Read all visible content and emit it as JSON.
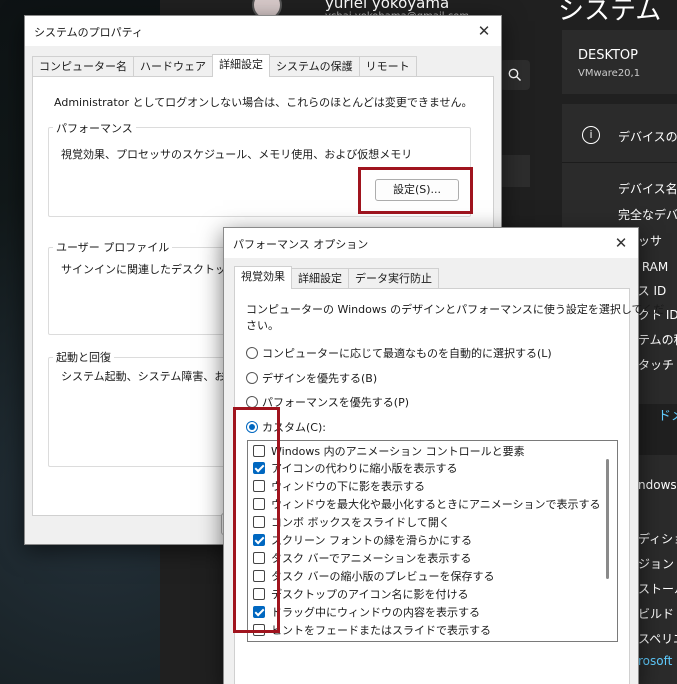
{
  "background": {
    "user_name": "yuriei yokoyama",
    "user_email": "ychai.yokohama@gmail.com",
    "page_title": "システム",
    "device_name": "DESKTOP",
    "device_sub": "VMware20,1",
    "device_card_title": "デバイスの仕様",
    "specs": [
      "デバイス名",
      "完全なデバ",
      "セッサ",
      "装 RAM",
      "イス ID",
      "ダクト ID",
      "ステムの種",
      "とタッチ"
    ],
    "link_text": "ドメ",
    "windows_label": "ndows",
    "edition_specs": [
      "ディション",
      "ジョン",
      "ストール",
      "ビルド",
      "スペリエ"
    ],
    "ms_link": "rosoft"
  },
  "system_properties": {
    "title": "システムのプロパティ",
    "tabs": [
      "コンピューター名",
      "ハードウェア",
      "詳細設定",
      "システムの保護",
      "リモート"
    ],
    "active_tab": 2,
    "admin_note": "Administrator としてログオンしない場合は、これらのほとんどは変更できません。",
    "performance": {
      "label": "パフォーマンス",
      "description": "視覚効果、プロセッサのスケジュール、メモリ使用、および仮想メモリ",
      "settings_button": "設定(S)..."
    },
    "user_profile": {
      "label": "ユーザー プロファイル",
      "description": "サインインに関連したデスクトップ設定"
    },
    "startup": {
      "label": "起動と回復",
      "description": "システム起動、システム障害、および"
    }
  },
  "performance_options": {
    "title": "パフォーマンス オプション",
    "tabs": [
      "視覚効果",
      "詳細設定",
      "データ実行防止"
    ],
    "active_tab": 0,
    "intro_line1": "コンピューターの Windows のデザインとパフォーマンスに使う設定を選択してくだ",
    "intro_line2": "さい。",
    "radios": [
      {
        "label": "コンピューターに応じて最適なものを自動的に選択する(L)",
        "selected": false
      },
      {
        "label": "デザインを優先する(B)",
        "selected": false
      },
      {
        "label": "パフォーマンスを優先する(P)",
        "selected": false
      },
      {
        "label": "カスタム(C):",
        "selected": true
      }
    ],
    "effects": [
      {
        "label": "Windows 内のアニメーション コントロールと要素",
        "checked": false
      },
      {
        "label": "アイコンの代わりに縮小版を表示する",
        "checked": true
      },
      {
        "label": "ウィンドウの下に影を表示する",
        "checked": false
      },
      {
        "label": "ウィンドウを最大化や最小化するときにアニメーションで表示する",
        "checked": false
      },
      {
        "label": "コンボ ボックスをスライドして開く",
        "checked": false
      },
      {
        "label": "スクリーン フォントの縁を滑らかにする",
        "checked": true
      },
      {
        "label": "タスク バーでアニメーションを表示する",
        "checked": false
      },
      {
        "label": "タスク バーの縮小版のプレビューを保存する",
        "checked": false
      },
      {
        "label": "デスクトップのアイコン名に影を付ける",
        "checked": false
      },
      {
        "label": "ドラッグ中にウィンドウの内容を表示する",
        "checked": true
      },
      {
        "label": "ヒントをフェードまたはスライドで表示する",
        "checked": false
      }
    ]
  }
}
